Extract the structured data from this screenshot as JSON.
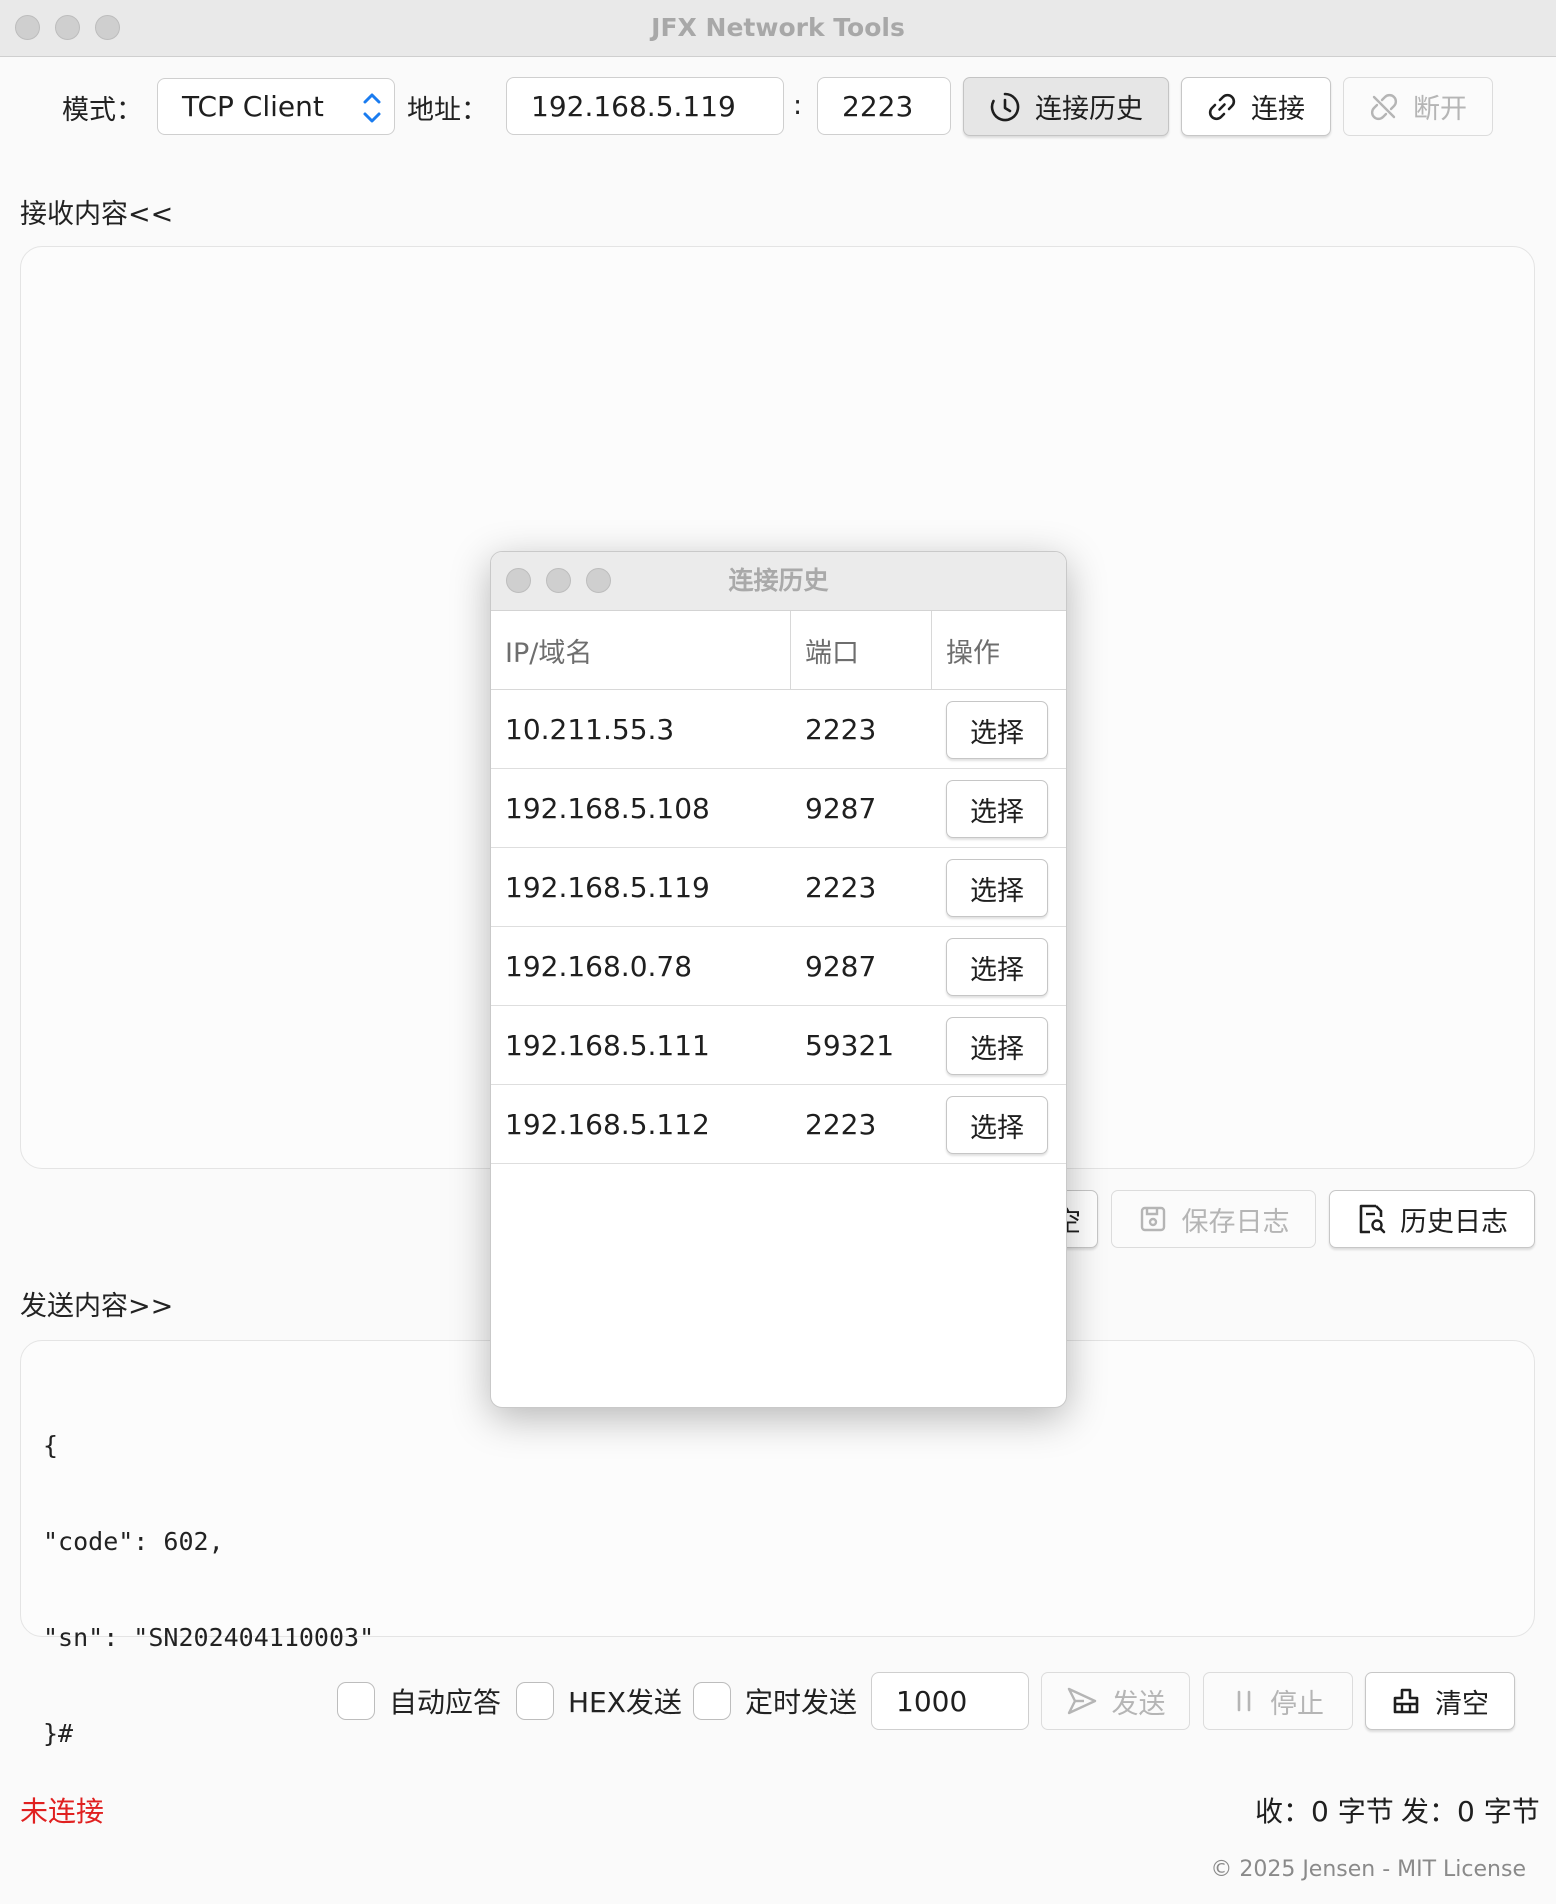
{
  "window": {
    "title": "JFX Network Tools"
  },
  "toolbar": {
    "mode_label": "模式：",
    "mode_value": "TCP Client",
    "address_label": "地址：",
    "address_value": "192.168.5.119",
    "port_separator": ":",
    "port_value": "2223",
    "history_button": "连接历史",
    "connect_button": "连接",
    "disconnect_button": "断开"
  },
  "receive": {
    "label": "接收内容<<",
    "clear_button_partial": "空",
    "save_log_button": "保存日志",
    "history_log_button": "历史日志"
  },
  "send": {
    "label": "发送内容>>",
    "content_lines": [
      "{",
      "\"code\": 602,",
      "\"sn\": \"SN202404110003\"",
      "}#"
    ],
    "auto_reply_label": "自动应答",
    "hex_send_label": "HEX发送",
    "timed_send_label": "定时发送",
    "interval_value": "1000",
    "send_button": "发送",
    "stop_button": "停止",
    "clear_button": "清空"
  },
  "status": {
    "connection": "未连接",
    "received": "收：0 字节",
    "sent": "发：0 字节"
  },
  "footer": {
    "copyright": "© 2025 Jensen - MIT License"
  },
  "dialog": {
    "title": "连接历史",
    "columns": [
      "IP/域名",
      "端口",
      "操作"
    ],
    "rows": [
      {
        "ip": "10.211.55.3",
        "port": "2223",
        "action": "选择"
      },
      {
        "ip": "192.168.5.108",
        "port": "9287",
        "action": "选择"
      },
      {
        "ip": "192.168.5.119",
        "port": "2223",
        "action": "选择"
      },
      {
        "ip": "192.168.0.78",
        "port": "9287",
        "action": "选择"
      },
      {
        "ip": "192.168.5.111",
        "port": "59321",
        "action": "选择"
      },
      {
        "ip": "192.168.5.112",
        "port": "2223",
        "action": "选择"
      }
    ]
  },
  "colors": {
    "error": "#e02020",
    "accent": "#1a7cf0"
  }
}
